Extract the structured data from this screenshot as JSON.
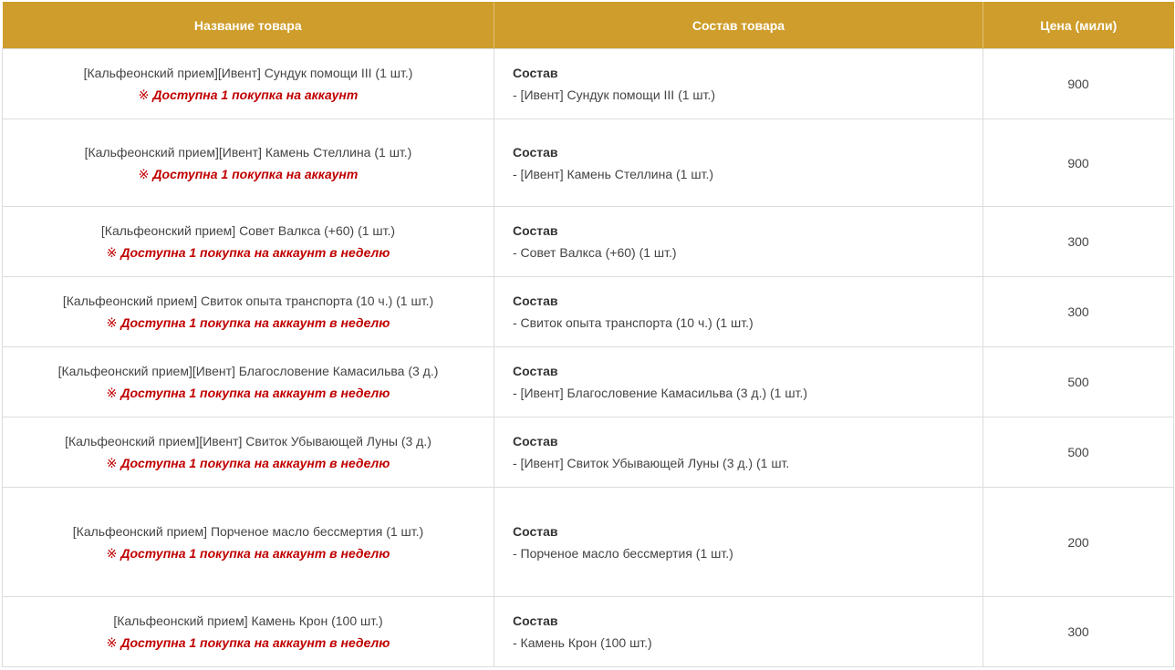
{
  "colors": {
    "header_bg": "#cf9d2b",
    "header_text": "#ffffff",
    "notice": "#c00000",
    "border": "#dcdcdc"
  },
  "header": {
    "name": "Название товара",
    "composition": "Состав товара",
    "price": "Цена (мили)"
  },
  "notice_mark": "※",
  "rows": [
    {
      "name": "[Кальфеонский прием][Ивент] Сундук помощи III (1 шт.)",
      "notice": "Доступна 1 покупка на аккаунт",
      "comp_head": "Состав",
      "comp_item": "- [Ивент] Сундук помощи III (1 шт.)",
      "price": "900"
    },
    {
      "name": "[Кальфеонский прием][Ивент] Камень Стеллина (1 шт.)",
      "notice": "Доступна 1 покупка на аккаунт",
      "comp_head": "Состав",
      "comp_item": "- [Ивент] Камень Стеллина (1 шт.)",
      "price": "900"
    },
    {
      "name": "[Кальфеонский прием] Совет Валкса (+60) (1 шт.)",
      "notice": "Доступна 1 покупка на аккаунт в неделю",
      "comp_head": "Состав",
      "comp_item": "- Совет Валкса (+60) (1 шт.)",
      "price": "300"
    },
    {
      "name": "[Кальфеонский прием] Свиток опыта транспорта (10 ч.) (1 шт.)",
      "notice": "Доступна 1 покупка на аккаунт в неделю",
      "comp_head": "Состав",
      "comp_item": "- Свиток опыта транспорта (10 ч.) (1 шт.)",
      "price": "300"
    },
    {
      "name": "[Кальфеонский прием][Ивент] Благословение Камасильва (3 д.)",
      "notice": "Доступна 1 покупка на аккаунт в неделю",
      "comp_head": "Состав",
      "comp_item": "- [Ивент] Благословение Камасильва (3 д.) (1 шт.)",
      "price": "500"
    },
    {
      "name": "[Кальфеонский прием][Ивент] Свиток Убывающей Луны (3 д.)",
      "notice": "Доступна 1 покупка на аккаунт в неделю",
      "comp_head": "Состав",
      "comp_item": "- [Ивент] Свиток Убывающей Луны (3 д.) (1 шт.",
      "price": "500"
    },
    {
      "name": "[Кальфеонский прием] Порченое масло бессмертия (1 шт.)",
      "notice": "Доступна 1 покупка на аккаунт в неделю",
      "comp_head": "Состав",
      "comp_item": "- Порченое масло бессмертия (1 шт.)",
      "price": "200"
    },
    {
      "name": "[Кальфеонский прием] Камень Крон (100 шт.)",
      "notice": "Доступна 1 покупка на аккаунт в неделю",
      "comp_head": "Состав",
      "comp_item": "- Камень Крон (100 шт.)",
      "price": "300"
    }
  ]
}
